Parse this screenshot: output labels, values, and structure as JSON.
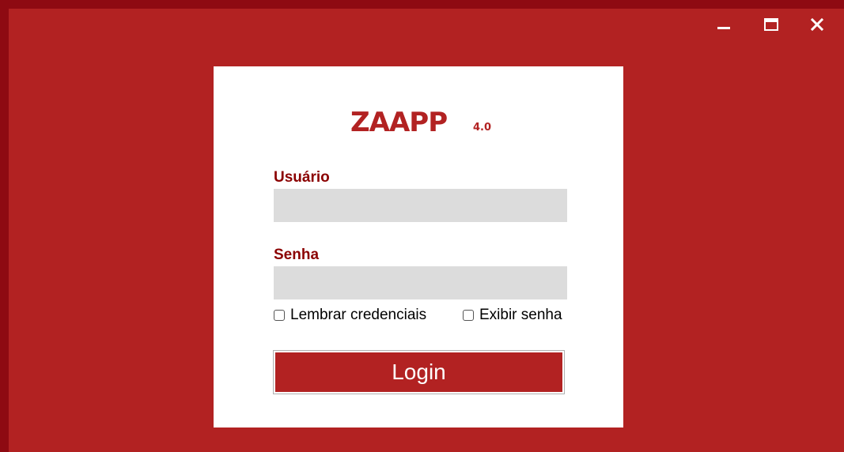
{
  "window": {
    "background_color": "#b22222",
    "controls": {
      "minimize_icon": "minimize-icon",
      "maximize_icon": "maximize-icon",
      "close_icon": "close-icon"
    }
  },
  "login": {
    "logo": {
      "name": "ZAAPP",
      "version": "4.0"
    },
    "username": {
      "label": "Usuário",
      "value": "",
      "placeholder": ""
    },
    "password": {
      "label": "Senha",
      "value": "",
      "placeholder": ""
    },
    "remember_credentials": {
      "label": "Lembrar credenciais",
      "checked": false
    },
    "show_password": {
      "label": "Exibir senha",
      "checked": false
    },
    "submit_label": "Login",
    "colors": {
      "accent": "#b22222",
      "label": "#8b0000",
      "input_background": "#dcdcdc"
    }
  }
}
